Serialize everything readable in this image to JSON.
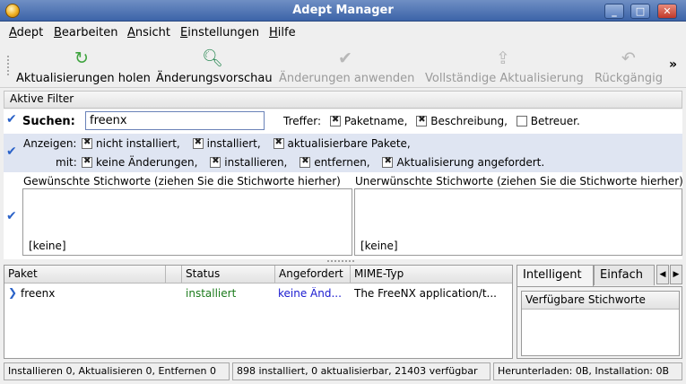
{
  "window": {
    "title": "Adept Manager",
    "controls": {
      "minimize": "_",
      "maximize": "□",
      "close": "✕"
    }
  },
  "menubar": {
    "items": [
      {
        "accel": "A",
        "rest": "dept"
      },
      {
        "accel": "B",
        "rest": "earbeiten"
      },
      {
        "accel": "A",
        "rest": "nsicht",
        "prefix": ""
      },
      {
        "accel": "E",
        "rest": "instellungen"
      },
      {
        "accel": "H",
        "rest": "ilfe"
      }
    ]
  },
  "toolbar": {
    "fetch": {
      "label": "Aktualisierungen holen",
      "icon": "refresh-icon"
    },
    "preview": {
      "label": "Änderungsvorschau",
      "icon": "preview-magnifier-icon"
    },
    "apply": {
      "label": "Änderungen anwenden",
      "icon": "checkmark-icon"
    },
    "full_upgrade": {
      "label": "Vollständige Aktualisierung",
      "icon": "upgrade-arrow-icon"
    },
    "undo": {
      "label": "Rückgängig",
      "icon": "undo-icon"
    },
    "more": "»"
  },
  "filter": {
    "header": "Aktive Filter",
    "search_label": "Suchen:",
    "search_value": "freenx",
    "matches_label": "Treffer:",
    "matches": [
      {
        "label": "Paketname,",
        "checked": true
      },
      {
        "label": "Beschreibung,",
        "checked": true
      },
      {
        "label": "Betreuer.",
        "checked": false
      }
    ],
    "show_label": "Anzeigen:",
    "show_options": [
      {
        "label": "nicht installiert,",
        "checked": true
      },
      {
        "label": "installiert,",
        "checked": true
      },
      {
        "label": "aktualisierbare Pakete,",
        "checked": true
      }
    ],
    "with_label": "mit:",
    "with_options": [
      {
        "label": "keine Änderungen,",
        "checked": true
      },
      {
        "label": "installieren,",
        "checked": true
      },
      {
        "label": "entfernen,",
        "checked": true
      },
      {
        "label": "Aktualisierung angefordert.",
        "checked": true
      }
    ],
    "wanted_keywords_title": "Gewünschte Stichworte (ziehen Sie die Stichworte hierher)",
    "unwanted_keywords_title": "Unerwünschte Stichworte (ziehen Sie die Stichworte hierher)",
    "wanted_empty": "[keine]",
    "unwanted_empty": "[keine]"
  },
  "packages": {
    "columns": [
      "Paket",
      "",
      "Status",
      "Angefordert",
      "MIME-Typ"
    ],
    "rows": [
      {
        "name": "freenx",
        "status": "installiert",
        "requested": "keine Änd...",
        "mime": "The FreeNX application/t..."
      }
    ],
    "colors": {
      "status": "#1a7a1a",
      "requested": "#1a1ad0"
    }
  },
  "side_tabs": {
    "tabs": [
      "Intelligent",
      "Einfach"
    ],
    "active": "Intelligent",
    "list_header": "Verfügbare Stichworte"
  },
  "statusbar": {
    "changes": "Installieren 0, Aktualisieren 0, Entfernen 0",
    "counts": "898 installiert, 0 aktualisierbar, 21403 verfügbar",
    "sizes": "Herunterladen: 0B, Installation: 0B"
  }
}
